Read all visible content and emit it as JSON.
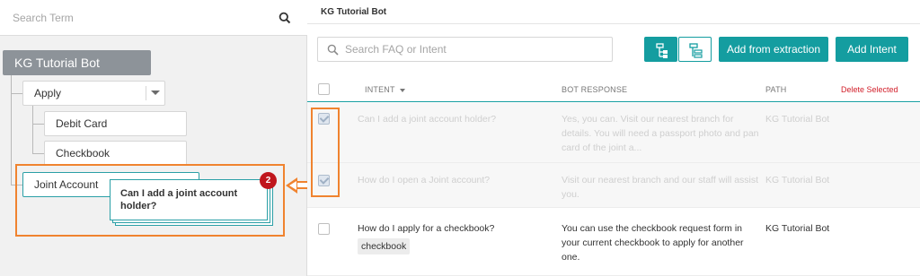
{
  "left_panel": {
    "search_placeholder": "Search Term",
    "search_icon": "search-icon",
    "tree": {
      "root": "KG Tutorial Bot",
      "apply": "Apply",
      "children": [
        "Debit Card",
        "Checkbook"
      ],
      "joint": "Joint Account"
    },
    "drag_preview": {
      "text": "Can I add a joint account holder?",
      "count": "2"
    }
  },
  "header": {
    "title": "KG Tutorial Bot"
  },
  "toolbar": {
    "search_placeholder": "Search FAQ or Intent",
    "tree_view_icon": "tree-view-icon",
    "list_view_icon": "list-view-icon",
    "add_from_extraction": "Add from extraction",
    "add_intent": "Add Intent"
  },
  "table": {
    "columns": {
      "intent": "INTENT",
      "bot_response": "BOT RESPONSE",
      "path": "PATH"
    },
    "delete_selected": "Delete Selected",
    "rows": [
      {
        "intent": "Can I add a joint account holder?",
        "response_lines": [
          "Yes, you can. Visit our nearest branch for",
          "details. You will need a passport photo and pan",
          "card of the joint a..."
        ],
        "path": "KG Tutorial Bot",
        "checked": true
      },
      {
        "intent": "How do I open a Joint account?",
        "response_lines": [
          "Visit our nearest branch and our staff will assist",
          "you."
        ],
        "path": "KG Tutorial Bot",
        "checked": true
      },
      {
        "intent": "How do I apply for a checkbook?",
        "tag": "checkbook",
        "response_lines": [
          "You can use the checkbook request form in",
          "your current checkbook to apply for another",
          "one."
        ],
        "path": "KG Tutorial Bot",
        "checked": false
      }
    ]
  },
  "colors": {
    "accent": "#149da0",
    "highlight": "#f0832f",
    "danger": "#d21f2a",
    "root_node": "#8d9399"
  }
}
